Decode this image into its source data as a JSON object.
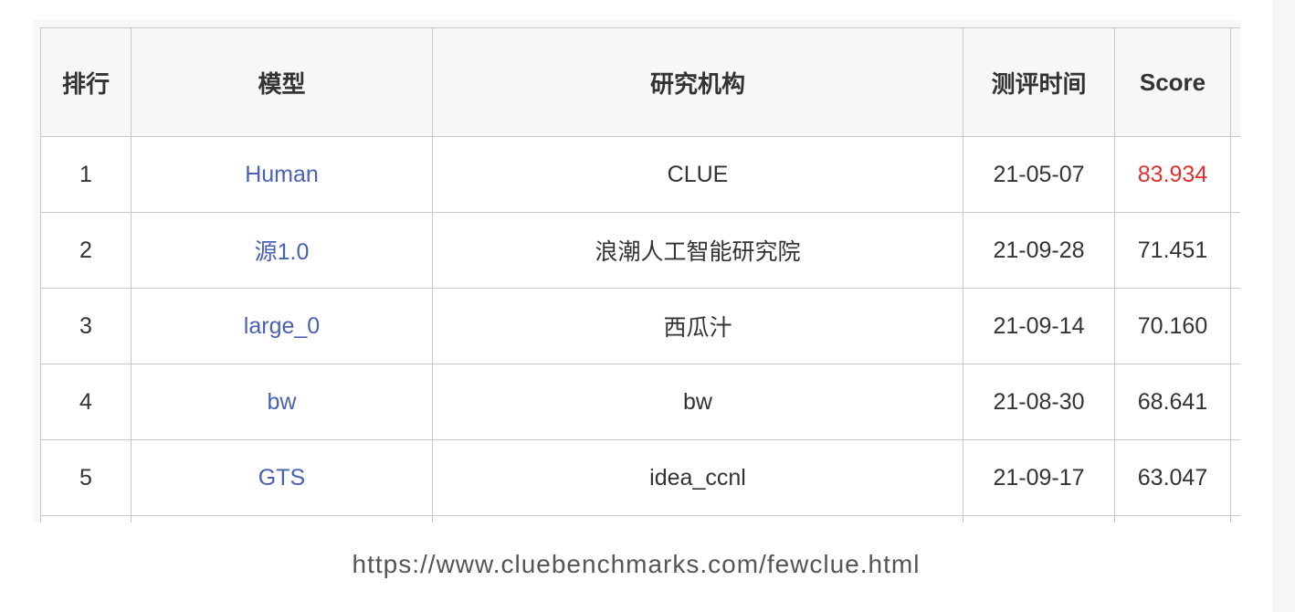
{
  "table": {
    "headers": [
      "排行",
      "模型",
      "研究机构",
      "测评时间",
      "Score"
    ],
    "rows": [
      {
        "rank": "1",
        "model": "Human",
        "org": "CLUE",
        "date": "21-05-07",
        "score": "83.934"
      },
      {
        "rank": "2",
        "model": "源1.0",
        "org": "浪潮人工智能研究院",
        "date": "21-09-28",
        "score": "71.451"
      },
      {
        "rank": "3",
        "model": "large_0",
        "org": "西瓜汁",
        "date": "21-09-14",
        "score": "70.160"
      },
      {
        "rank": "4",
        "model": "bw",
        "org": "bw",
        "date": "21-08-30",
        "score": "68.641"
      },
      {
        "rank": "5",
        "model": "GTS",
        "org": "idea_ccnl",
        "date": "21-09-17",
        "score": "63.047"
      }
    ]
  },
  "footer": {
    "url": "https://www.cluebenchmarks.com/fewclue.html"
  },
  "colors": {
    "link": "#4a60b0",
    "top_score": "#e0312f",
    "header_bg": "#f7f7f7",
    "border": "#c9c9c9"
  }
}
